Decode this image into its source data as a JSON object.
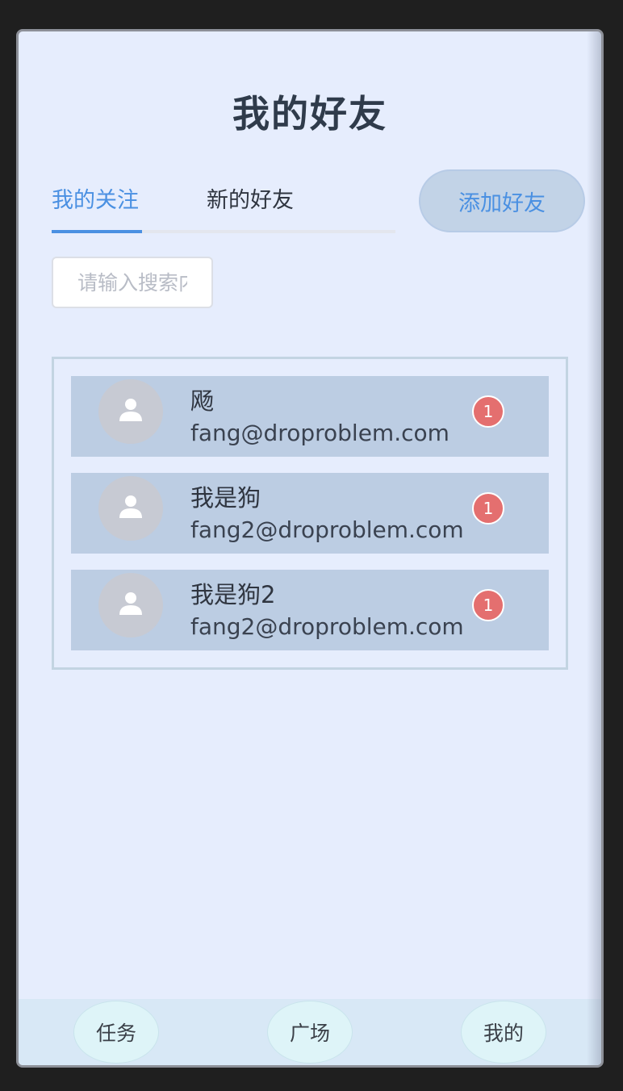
{
  "page": {
    "title": "我的好友"
  },
  "tabs": [
    {
      "label": "我的关注",
      "active": true
    },
    {
      "label": "新的好友",
      "active": false
    }
  ],
  "add_friend_label": "添加好友",
  "search": {
    "placeholder": "请输入搜索内容",
    "value": ""
  },
  "friends": [
    {
      "name": "飏",
      "email": "fang@droproblem.com",
      "unread": "1"
    },
    {
      "name": "我是狗",
      "email": "fang2@droproblem.com",
      "unread": "1"
    },
    {
      "name": "我是狗2",
      "email": "fang2@droproblem.com",
      "unread": "1"
    }
  ],
  "bottom_nav": [
    {
      "label": "任务"
    },
    {
      "label": "广场"
    },
    {
      "label": "我的"
    }
  ],
  "colors": {
    "accent": "#4a90e2",
    "background": "#e6edfd",
    "list_item": "#bccde3",
    "badge": "#e46f6f"
  }
}
